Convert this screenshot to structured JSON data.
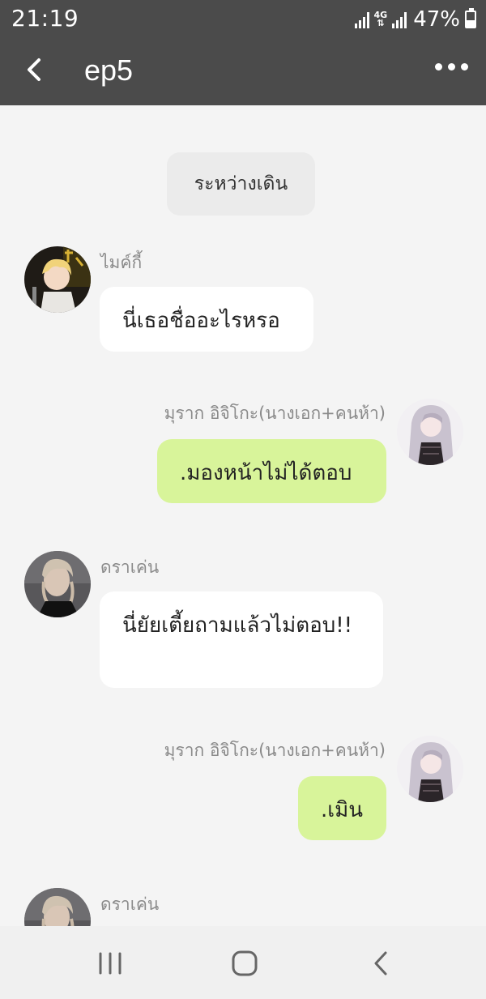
{
  "status_bar": {
    "time": "21:19",
    "network": "4G",
    "battery": "47%",
    "battery_level": 0.47
  },
  "header": {
    "title": "ep5",
    "back_icon": "chevron-left-icon",
    "menu_icon": "more-horizontal-icon"
  },
  "chat": {
    "system_message": "ระหว่างเดิน",
    "messages": [
      {
        "sender": "ไมค์กี้",
        "text": "นี่เธอชื่ออะไรหรอ",
        "side": "in"
      },
      {
        "sender": "มุราก อิจิโกะ(นางเอก+คนห้า)",
        "text": ".มองหน้าไม่ได้ตอบ",
        "side": "out"
      },
      {
        "sender": "ดราเค่น",
        "text": "นี่ยัยเตี้ยถามแล้วไม่ตอบ!!",
        "side": "in"
      },
      {
        "sender": "มุราก อิจิโกะ(นางเอก+คนห้า)",
        "text": ".เมิน",
        "side": "out"
      },
      {
        "sender": "ดราเค่น",
        "text": "",
        "side": "in"
      }
    ]
  },
  "nav_bar": {
    "recent_icon": "recent-apps-icon",
    "home_icon": "home-icon",
    "back_icon": "back-icon"
  },
  "colors": {
    "header_bg": "#4b4b4b",
    "outgoing_bubble": "#d8f49a",
    "incoming_bubble": "#ffffff",
    "background": "#f4f4f4"
  }
}
